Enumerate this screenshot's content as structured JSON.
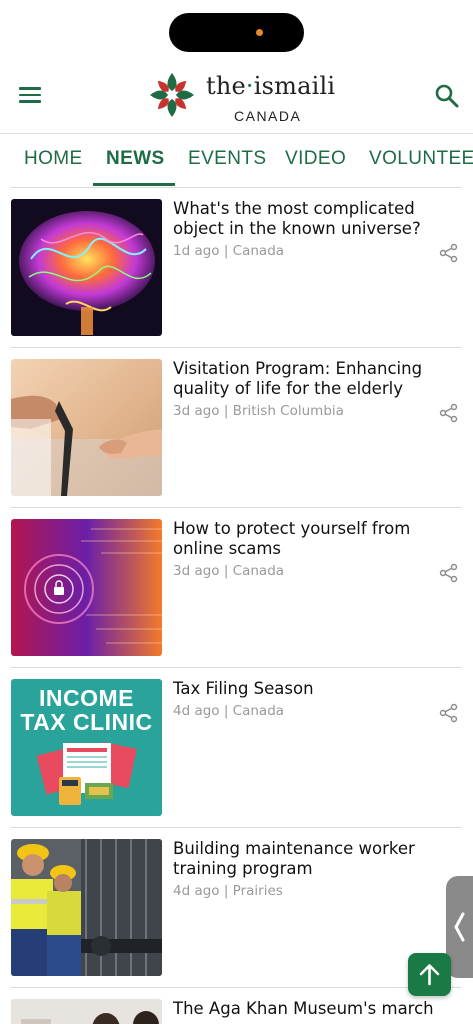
{
  "header": {
    "brand_left": "the",
    "brand_dot": "·",
    "brand_right": "ismaili",
    "region": "CANADA",
    "menu_icon": "hamburger-menu-icon",
    "search_icon": "search-icon",
    "accent_color": "#1e6b45"
  },
  "tabs": [
    {
      "label": "HOME",
      "active": false
    },
    {
      "label": "NEWS",
      "active": true
    },
    {
      "label": "EVENTS",
      "active": false
    },
    {
      "label": "VIDEO",
      "active": false
    },
    {
      "label": "VOLUNTEER",
      "active": false
    }
  ],
  "articles": [
    {
      "title": "What's the most complicated object in the known universe?",
      "meta": "1d ago | Canada",
      "thumb": "neon-brain-image"
    },
    {
      "title": "Visitation Program: Enhancing quality of life for the elderly",
      "meta": "3d ago | British Columbia",
      "thumb": "helping-hands-cane-image"
    },
    {
      "title": "How to protect yourself from online scams",
      "meta": "3d ago | Canada",
      "thumb": "cyber-security-lock-image"
    },
    {
      "title": "Tax Filing Season",
      "meta": "4d ago | Canada",
      "thumb": "income-tax-clinic-image",
      "thumb_text_1": "INCOME",
      "thumb_text_2": "TAX CLINIC"
    },
    {
      "title": "Building maintenance worker training program",
      "meta": "4d ago | Prairies",
      "thumb": "workers-hard-hats-image"
    },
    {
      "title": "The Aga Khan Museum's march",
      "meta": "",
      "thumb": "museum-people-image"
    }
  ],
  "controls": {
    "scroll_top_icon": "arrow-up-icon",
    "side_panel_icon": "chevron-left-icon"
  }
}
